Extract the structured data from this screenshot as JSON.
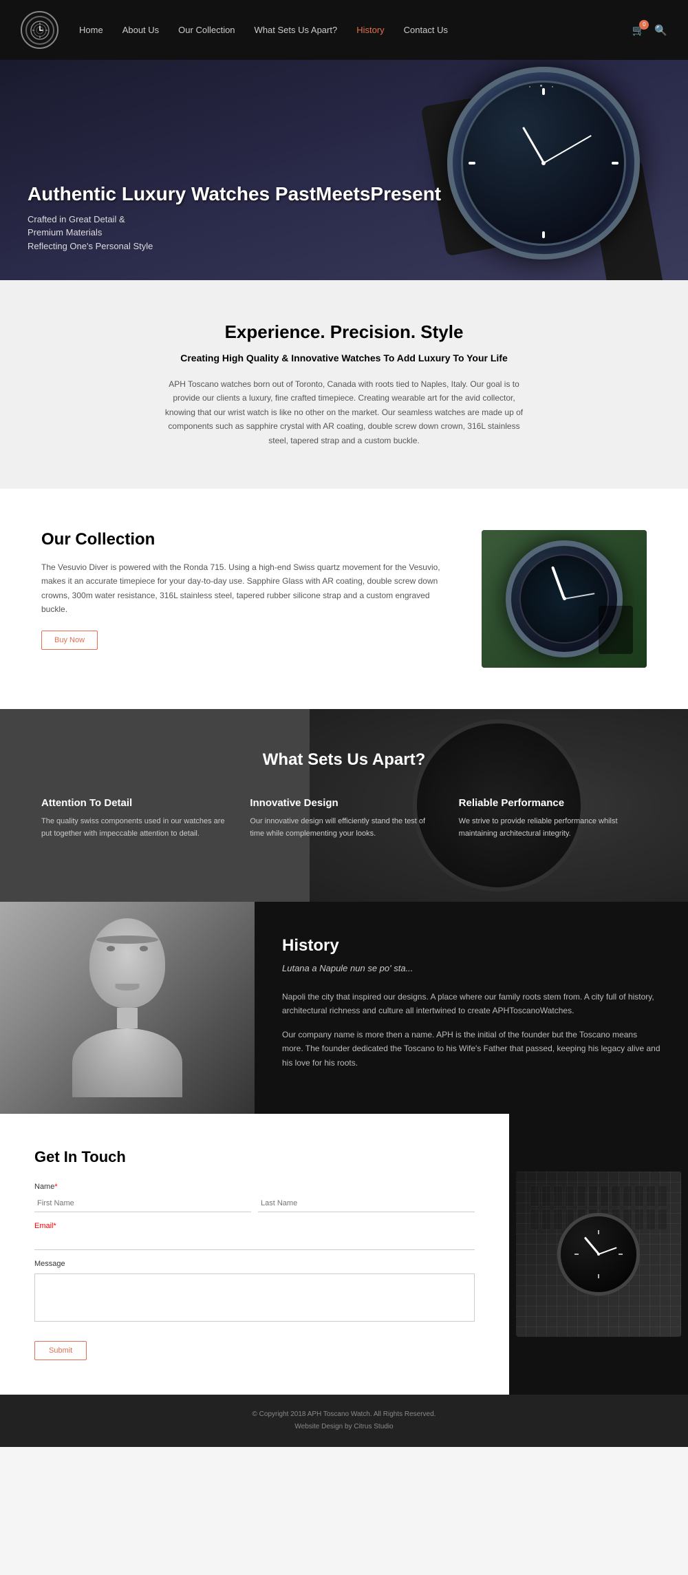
{
  "nav": {
    "logo_text": "APH",
    "links": [
      {
        "label": "Home",
        "active": false
      },
      {
        "label": "About Us",
        "active": false
      },
      {
        "label": "Our Collection",
        "active": false
      },
      {
        "label": "What Sets Us Apart?",
        "active": false
      },
      {
        "label": "History",
        "active": true
      },
      {
        "label": "Contact Us",
        "active": false
      }
    ],
    "cart_count": "0"
  },
  "hero": {
    "title": "Authentic Luxury Watches PastMeetsPresent",
    "subtitle_line1": "Crafted in Great Detail &",
    "subtitle_line2": "Premium Materials",
    "subtitle_line3": "Reflecting One's Personal Style"
  },
  "experience": {
    "heading": "Experience. Precision. Style",
    "subheading": "Creating High Quality & Innovative Watches To Add Luxury To Your Life",
    "body": "APH Toscano watches born out of Toronto, Canada with roots tied to Naples, Italy. Our goal is to provide our clients a luxury, fine crafted timepiece. Creating wearable art for the avid collector, knowing that our wrist watch is like no other on the market. Our seamless watches are made up of components such as sapphire crystal with AR coating, double screw down crown, 316L stainless steel, tapered strap and a custom buckle."
  },
  "collection": {
    "heading": "Our Collection",
    "body": "The Vesuvio Diver is powered with the Ronda 715. Using a high-end Swiss quartz movement for the Vesuvio, makes it an accurate timepiece for your day-to-day use. Sapphire Glass with AR coating, double screw down crowns, 300m water resistance, 316L stainless steel, tapered rubber silicone strap and a custom engraved buckle.",
    "buy_btn": "Buy Now"
  },
  "apart": {
    "heading": "What Sets Us Apart?",
    "features": [
      {
        "title": "Attention To Detail",
        "body": "The quality swiss components used in our watches are put together with impeccable attention to detail."
      },
      {
        "title": "Innovative Design",
        "body": "Our innovative design will efficiently stand the test of time while complementing your looks."
      },
      {
        "title": "Reliable Performance",
        "body": "We strive to provide reliable performance whilst maintaining architectural integrity."
      }
    ]
  },
  "history": {
    "heading": "History",
    "subtitle": "Lutana a Napule nun se po' sta...",
    "para1": "Napoli the city that inspired our designs. A place where our family roots stem from. A city full of history, architectural richness and culture all intertwined to create APHToscanoWatches.",
    "para2": "Our company name is more then a name. APH is the initial of the founder but the Toscano means more. The founder dedicated the Toscano to his Wife's Father that passed, keeping his legacy alive and his love for his roots."
  },
  "contact": {
    "heading": "Get In Touch",
    "name_label": "Name",
    "name_required": "*",
    "first_name_placeholder": "First Name",
    "last_name_placeholder": "Last Name",
    "email_label": "Email",
    "email_required": "*",
    "message_label": "Message",
    "submit_btn": "Submit"
  },
  "footer": {
    "copyright": "© Copyright 2018 APH Toscano Watch. All Rights Reserved.",
    "design": "Website Design by Citrus Studio"
  }
}
